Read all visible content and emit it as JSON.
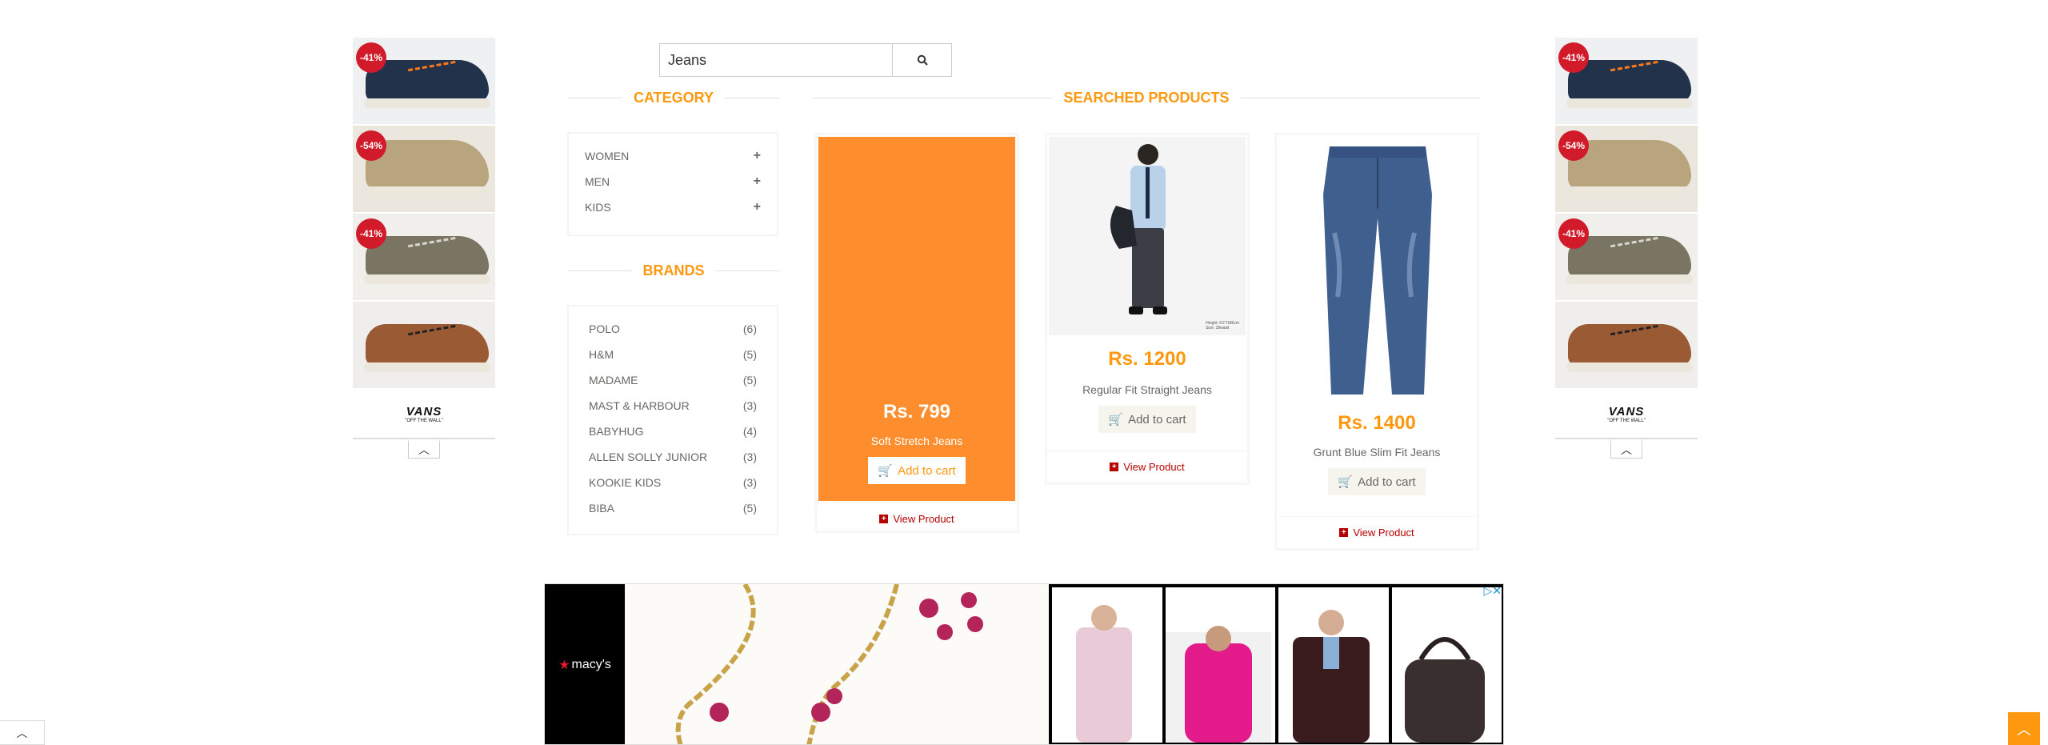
{
  "search": {
    "value": "Jeans",
    "button_icon": "search-icon"
  },
  "category": {
    "title": "Category",
    "items": [
      {
        "label": "WOMEN",
        "icon": "plus-icon"
      },
      {
        "label": "MEN",
        "icon": "plus-icon"
      },
      {
        "label": "KIDS",
        "icon": "plus-icon"
      }
    ]
  },
  "brands": {
    "title": "Brands",
    "items": [
      {
        "name": "POLO",
        "count": "(6)"
      },
      {
        "name": "H&M",
        "count": "(5)"
      },
      {
        "name": "MADAME",
        "count": "(5)"
      },
      {
        "name": "MAST & HARBOUR",
        "count": "(3)"
      },
      {
        "name": "BABYHUG",
        "count": "(4)"
      },
      {
        "name": "ALLEN SOLLY JUNIOR",
        "count": "(3)"
      },
      {
        "name": "KOOKIE KIDS",
        "count": "(3)"
      },
      {
        "name": "BIBA",
        "count": "(5)"
      }
    ]
  },
  "products_section": {
    "title": "Searched Products"
  },
  "products": [
    {
      "price": "Rs. 799",
      "name": "Soft Stretch Jeans",
      "cart_label": "Add to cart",
      "view_label": "View Product"
    },
    {
      "price": "Rs. 1200",
      "name": "Regular Fit Straight Jeans",
      "cart_label": "Add to cart",
      "view_label": "View Product",
      "image_caption": "Height: 6'2\"/186cm\nSize: 39waist"
    },
    {
      "price": "Rs. 1400",
      "name": "Grunt Blue Slim Fit Jeans",
      "cart_label": "Add to cart",
      "view_label": "View Product"
    }
  ],
  "side_ads": {
    "discounts": [
      "-41%",
      "-54%",
      "-41%"
    ],
    "brand": "VANS",
    "brand_tagline": "\"OFF THE WALL\""
  },
  "bottom_ad": {
    "brand": "macy's"
  },
  "colors": {
    "accent": "#fe980f",
    "link": "#b50000",
    "text": "#696763"
  }
}
